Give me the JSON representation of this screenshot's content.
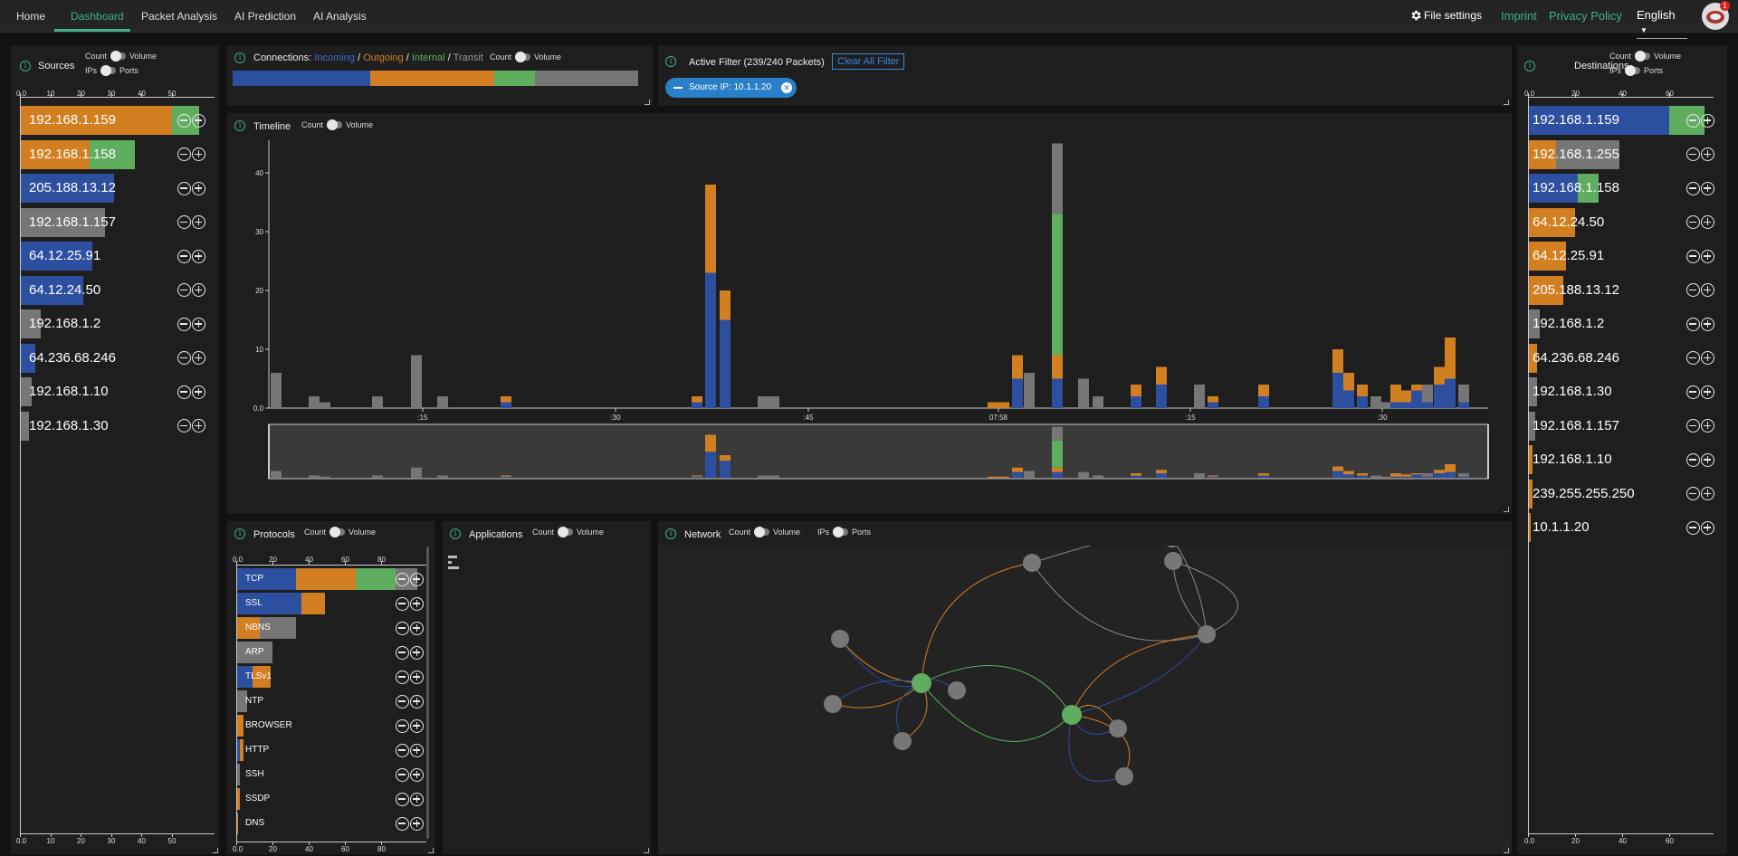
{
  "nav": {
    "links": [
      "Home",
      "Dashboard",
      "Packet Analysis",
      "AI Prediction",
      "AI Analysis"
    ],
    "file_settings": "File settings",
    "imprint": "Imprint",
    "privacy": "Privacy Policy",
    "language": "English"
  },
  "colors": {
    "incoming": "#2d4fa0",
    "outgoing": "#d27f22",
    "internal": "#5fad5f",
    "transit": "#767676",
    "accent": "#3fb08a"
  },
  "toggles": {
    "count": "Count",
    "volume": "Volume",
    "ips": "IPs",
    "ports": "Ports"
  },
  "sources": {
    "title": "Sources",
    "axis_ticks": [
      "0.0",
      "10",
      "20",
      "30",
      "40",
      "50"
    ],
    "rows": [
      {
        "ip": "192.168.1.159",
        "segments": [
          {
            "type": "outgoing",
            "value": 50
          },
          {
            "type": "internal",
            "value": 9
          }
        ]
      },
      {
        "ip": "192.168.1.158",
        "segments": [
          {
            "type": "outgoing",
            "value": 23
          },
          {
            "type": "internal",
            "value": 15
          }
        ]
      },
      {
        "ip": "205.188.13.12",
        "segments": [
          {
            "type": "incoming",
            "value": 31
          }
        ]
      },
      {
        "ip": "192.168.1.157",
        "segments": [
          {
            "type": "transit",
            "value": 28
          }
        ]
      },
      {
        "ip": "64.12.25.91",
        "segments": [
          {
            "type": "incoming",
            "value": 24
          }
        ]
      },
      {
        "ip": "64.12.24.50",
        "segments": [
          {
            "type": "incoming",
            "value": 21
          }
        ]
      },
      {
        "ip": "192.168.1.2",
        "segments": [
          {
            "type": "transit",
            "value": 7
          }
        ]
      },
      {
        "ip": "64.236.68.246",
        "segments": [
          {
            "type": "incoming",
            "value": 5
          }
        ]
      },
      {
        "ip": "192.168.1.10",
        "segments": [
          {
            "type": "transit",
            "value": 4
          }
        ]
      },
      {
        "ip": "192.168.1.30",
        "segments": [
          {
            "type": "transit",
            "value": 3
          }
        ]
      }
    ]
  },
  "connections": {
    "title": "Connections:",
    "legend": [
      {
        "label": "Incoming",
        "type": "incoming"
      },
      {
        "label": "Outgoing",
        "type": "outgoing"
      },
      {
        "label": "Internal",
        "type": "internal"
      },
      {
        "label": "Transit",
        "type": "transit"
      }
    ],
    "sep": " / ",
    "shares": [
      {
        "type": "incoming",
        "value": 34
      },
      {
        "type": "outgoing",
        "value": 30.5
      },
      {
        "type": "internal",
        "value": 10
      },
      {
        "type": "transit",
        "value": 25.5
      }
    ]
  },
  "filter": {
    "title": "Active Filter (239/240 Packets)",
    "clear": "Clear All Filter",
    "chips": [
      "Source IP: 10.1.1.20"
    ]
  },
  "timeline": {
    "title": "Timeline",
    "y_ticks": [
      "0.0",
      "10",
      "20",
      "30",
      "40"
    ],
    "x_ticks": [
      ":15",
      ":30",
      ":45",
      "07:58",
      ":15",
      ":30"
    ]
  },
  "destinations": {
    "title": "Destinations",
    "axis_ticks": [
      "0.0",
      "20",
      "40",
      "60"
    ],
    "rows": [
      {
        "ip": "192.168.1.159",
        "segments": [
          {
            "type": "incoming",
            "value": 60
          },
          {
            "type": "internal",
            "value": 15
          }
        ]
      },
      {
        "ip": "192.168.1.255",
        "segments": [
          {
            "type": "outgoing",
            "value": 12
          },
          {
            "type": "transit",
            "value": 27
          }
        ]
      },
      {
        "ip": "192.168.1.158",
        "segments": [
          {
            "type": "incoming",
            "value": 21
          },
          {
            "type": "internal",
            "value": 9
          }
        ]
      },
      {
        "ip": "64.12.24.50",
        "segments": [
          {
            "type": "outgoing",
            "value": 20
          }
        ]
      },
      {
        "ip": "64.12.25.91",
        "segments": [
          {
            "type": "outgoing",
            "value": 16
          }
        ]
      },
      {
        "ip": "205.188.13.12",
        "segments": [
          {
            "type": "outgoing",
            "value": 15
          }
        ]
      },
      {
        "ip": "192.168.1.2",
        "segments": [
          {
            "type": "transit",
            "value": 5
          }
        ]
      },
      {
        "ip": "64.236.68.246",
        "segments": [
          {
            "type": "outgoing",
            "value": 4
          }
        ]
      },
      {
        "ip": "192.168.1.30",
        "segments": [
          {
            "type": "transit",
            "value": 4
          }
        ]
      },
      {
        "ip": "192.168.1.157",
        "segments": [
          {
            "type": "transit",
            "value": 3
          }
        ]
      },
      {
        "ip": "192.168.1.10",
        "segments": [
          {
            "type": "outgoing",
            "value": 2
          }
        ]
      },
      {
        "ip": "239.255.255.250",
        "segments": [
          {
            "type": "outgoing",
            "value": 2
          }
        ]
      },
      {
        "ip": "10.1.1.20",
        "segments": [
          {
            "type": "outgoing",
            "value": 1
          }
        ]
      }
    ]
  },
  "protocols": {
    "title": "Protocols",
    "axis_ticks": [
      "0.0",
      "20",
      "40",
      "60",
      "80"
    ],
    "rows": [
      {
        "name": "TCP",
        "segments": [
          {
            "type": "incoming",
            "value": 33
          },
          {
            "type": "outgoing",
            "value": 33
          },
          {
            "type": "internal",
            "value": 22
          },
          {
            "type": "transit",
            "value": 12
          }
        ]
      },
      {
        "name": "SSL",
        "segments": [
          {
            "type": "incoming",
            "value": 36
          },
          {
            "type": "outgoing",
            "value": 13
          }
        ]
      },
      {
        "name": "NBNS",
        "segments": [
          {
            "type": "outgoing",
            "value": 13
          },
          {
            "type": "transit",
            "value": 20
          }
        ]
      },
      {
        "name": "ARP",
        "segments": [
          {
            "type": "transit",
            "value": 20
          }
        ]
      },
      {
        "name": "TLSv1",
        "segments": [
          {
            "type": "incoming",
            "value": 9
          },
          {
            "type": "outgoing",
            "value": 10
          }
        ]
      },
      {
        "name": "NTP",
        "segments": [
          {
            "type": "transit",
            "value": 6
          }
        ]
      },
      {
        "name": "BROWSER",
        "segments": [
          {
            "type": "outgoing",
            "value": 4
          }
        ]
      },
      {
        "name": "HTTP",
        "segments": [
          {
            "type": "incoming",
            "value": 2
          },
          {
            "type": "outgoing",
            "value": 2
          }
        ]
      },
      {
        "name": "SSH",
        "segments": [
          {
            "type": "transit",
            "value": 2
          }
        ]
      },
      {
        "name": "SSDP",
        "segments": [
          {
            "type": "outgoing",
            "value": 2
          }
        ]
      },
      {
        "name": "DNS",
        "segments": [
          {
            "type": "outgoing",
            "value": 1
          }
        ]
      }
    ]
  },
  "applications": {
    "title": "Applications"
  },
  "network": {
    "title": "Network"
  }
}
